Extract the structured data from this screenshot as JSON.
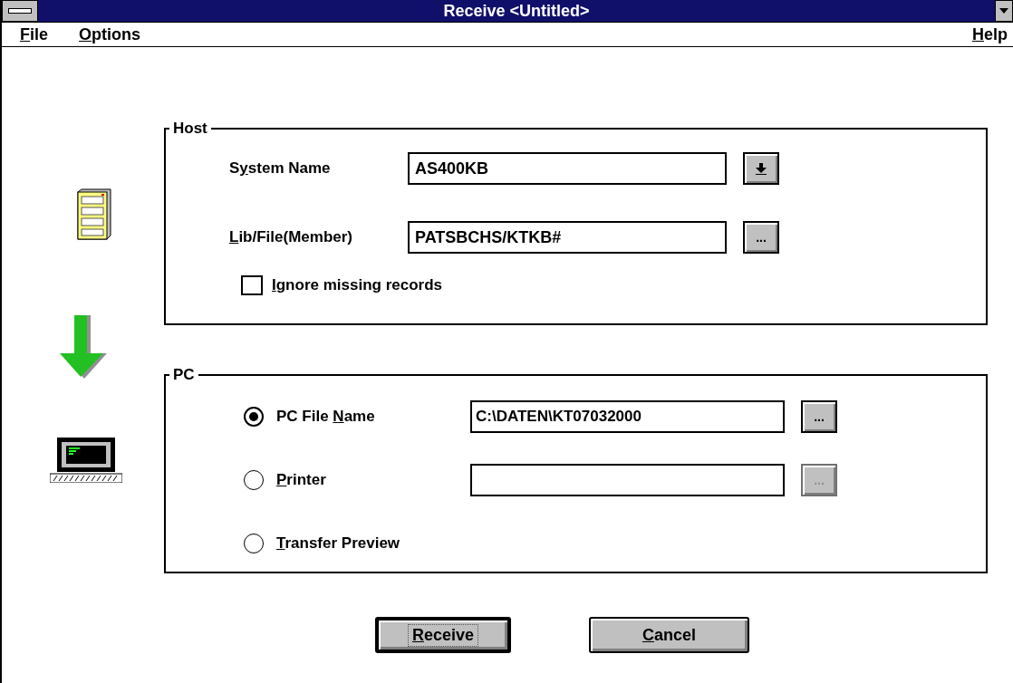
{
  "window": {
    "title": "Receive <Untitled>"
  },
  "menu": [
    {
      "key": "F",
      "rest": "ile"
    },
    {
      "key": "O",
      "rest": "ptions"
    },
    {
      "key": "H",
      "rest": "elp"
    }
  ],
  "host": {
    "title": "Host",
    "system_name": {
      "label": {
        "lead": "S",
        "key": "y",
        "rest": "stem Name"
      },
      "value": "AS400KB"
    },
    "lib_file": {
      "label": {
        "key": "L",
        "rest": "ib/File(Member)"
      },
      "value": "PATSBCHS/KTKB#",
      "browse": "..."
    },
    "ignore_missing": {
      "label": {
        "key": "I",
        "rest": "gnore missing records"
      },
      "checked": false
    }
  },
  "pc": {
    "title": "PC",
    "options": [
      {
        "kind": "field",
        "label": {
          "lead": "PC File ",
          "key": "N",
          "rest": "ame"
        },
        "selected": true,
        "value": "C:\\DATEN\\KT07032000",
        "browse": "...",
        "browse_disabled": false
      },
      {
        "kind": "field",
        "label": {
          "key": "P",
          "rest": "rinter"
        },
        "selected": false,
        "browse": "...",
        "browse_disabled": true
      },
      {
        "kind": "plain",
        "label": {
          "key": "T",
          "rest": "ransfer Preview"
        },
        "selected": false
      }
    ]
  },
  "buttons": [
    {
      "label": {
        "key": "R",
        "rest": "eceive"
      },
      "default": true
    },
    {
      "label": {
        "key": "C",
        "rest": "ancel"
      },
      "default": false
    }
  ]
}
